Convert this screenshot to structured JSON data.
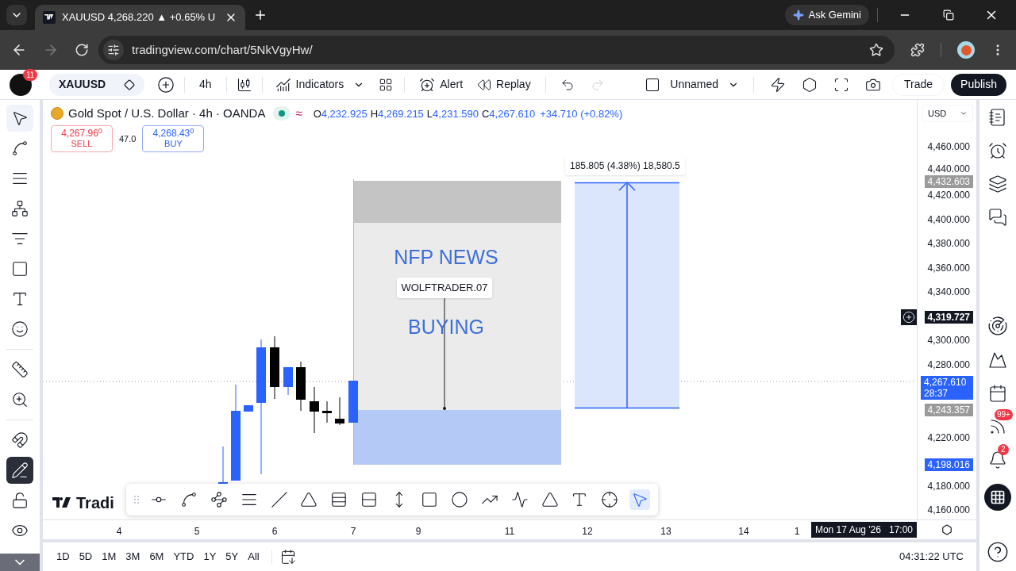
{
  "browser": {
    "tab_title": "XAUUSD 4,268.220 ▲ +0.65% U",
    "ask_gemini": "Ask Gemini",
    "url": "tradingview.com/chart/5NkVgyHw/",
    "forward_disabled": true
  },
  "toolbar": {
    "notification_count": "11",
    "symbol": "XAUUSD",
    "interval": "4h",
    "indicators": "Indicators",
    "alert": "Alert",
    "replay": "Replay",
    "redo_disabled": true,
    "layout_name": "Unnamed",
    "trade": "Trade",
    "publish": "Publish"
  },
  "legend": {
    "title": "Gold Spot / U.S. Dollar · 4h · OANDA",
    "market_open": true,
    "approx": "≈",
    "ohlc": [
      {
        "key": "O",
        "value": "4,232.925"
      },
      {
        "key": "H",
        "value": "4,269.215"
      },
      {
        "key": "L",
        "value": "4,231.590"
      },
      {
        "key": "C",
        "value": "4,267.610"
      }
    ],
    "change": "+34.710 (+0.82%)"
  },
  "quote": {
    "sell_price": "4,267.96$^{0}$",
    "sell": "SELL",
    "spread": "47.0",
    "buy_price": "4,268.43$^{0}$",
    "buy": "BUY"
  },
  "drawings": {
    "headline": "NFP NEWS",
    "callout": "WOLFTRADER.07",
    "action": "BUYING",
    "measure": "185.805 (4.38%) 18,580.5"
  },
  "logo_text": "Tradi",
  "price_axis": {
    "currency": "USD",
    "labels": [
      {
        "kind": "tick",
        "text": "4,460.000"
      },
      {
        "kind": "tick",
        "text": "4,440.000"
      },
      {
        "kind": "gray-tag",
        "text": "4,432.603"
      },
      {
        "kind": "tick",
        "text": "4,420.000"
      },
      {
        "kind": "tick",
        "text": "4,400.000"
      },
      {
        "kind": "tick",
        "text": "4,380.000"
      },
      {
        "kind": "tick",
        "text": "4,360.000"
      },
      {
        "kind": "tick",
        "text": "4,340.000"
      },
      {
        "kind": "dark-tag",
        "text": "4,319.727"
      },
      {
        "kind": "tick",
        "text": "4,300.000"
      },
      {
        "kind": "tick",
        "text": "4,280.000"
      },
      {
        "kind": "current",
        "text": "4,267.610",
        "countdown": "28:37"
      },
      {
        "kind": "gray-tag",
        "text": "4,243.357"
      },
      {
        "kind": "tick",
        "text": "4,220.000"
      },
      {
        "kind": "blue-tag",
        "text": "4,198.016"
      },
      {
        "kind": "tick",
        "text": "4,180.000"
      },
      {
        "kind": "tick",
        "text": "4,160.000"
      }
    ]
  },
  "time_axis": {
    "labels": [
      "4",
      "5",
      "6",
      "7",
      "9",
      "11",
      "12",
      "13",
      "14",
      "1"
    ],
    "cursor_date": "Mon 17 Aug '26",
    "cursor_time": "17:00"
  },
  "ranges": [
    "1D",
    "5D",
    "1M",
    "3M",
    "6M",
    "YTD",
    "1Y",
    "5Y",
    "All"
  ],
  "clock": "04:31:22 UTC",
  "left_tools": [
    {
      "kind": "cursor",
      "selected": true
    },
    {
      "kind": "trend-line",
      "selected": false
    },
    {
      "kind": "fib",
      "selected": false
    },
    {
      "kind": "pattern",
      "selected": false
    },
    {
      "kind": "position",
      "selected": false
    },
    {
      "kind": "rectangle",
      "selected": false
    },
    {
      "kind": "text",
      "selected": false
    },
    {
      "kind": "emoji",
      "selected": false
    },
    {
      "kind": "ruler",
      "selected": false
    },
    {
      "kind": "zoom",
      "selected": false
    }
  ],
  "left_toggles": [
    {
      "kind": "magnet",
      "on": false
    },
    {
      "kind": "lock-drawing",
      "on": true
    },
    {
      "kind": "lock",
      "on": false
    },
    {
      "kind": "visibility",
      "on": false
    }
  ],
  "floating_tools": [
    {
      "kind": "dot-line",
      "selected": false
    },
    {
      "kind": "curve",
      "selected": false
    },
    {
      "kind": "info-line",
      "selected": false
    },
    {
      "kind": "parallel",
      "selected": false
    },
    {
      "kind": "line",
      "selected": false
    },
    {
      "kind": "pitchfork",
      "selected": false
    },
    {
      "kind": "long-label",
      "selected": false
    },
    {
      "kind": "short-label",
      "selected": false
    },
    {
      "kind": "measure",
      "selected": false
    },
    {
      "kind": "rectangle",
      "selected": false
    },
    {
      "kind": "ellipse",
      "selected": false
    },
    {
      "kind": "path",
      "selected": false
    },
    {
      "kind": "polyline",
      "selected": false
    },
    {
      "kind": "triangle",
      "selected": false
    },
    {
      "kind": "text-note",
      "selected": false
    },
    {
      "kind": "crosshair",
      "selected": false
    },
    {
      "kind": "cursor",
      "selected": true
    }
  ],
  "sidebar_badges": {
    "feed": "99+",
    "alerts": "2"
  }
}
